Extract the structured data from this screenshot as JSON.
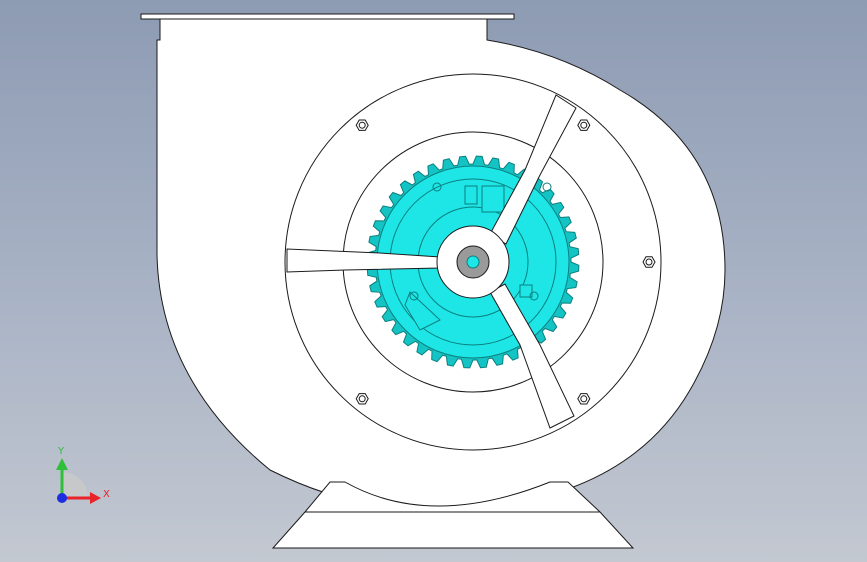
{
  "triad": {
    "x_label": "X",
    "y_label": "Y",
    "x_color": "#e8242a",
    "y_color": "#2fbf3a",
    "z_color": "#1c2ee0"
  },
  "colors": {
    "body_fill": "#ffffff",
    "outline": "#1a1a1a",
    "impeller_light": "#1ee6e6",
    "impeller_mid": "#14c4c4",
    "impeller_dark": "#0e9c9c",
    "hub_gray": "#9a9a9a"
  },
  "parts": {
    "impeller_teeth": 40,
    "spokes": 3,
    "bolt_holes": 6
  }
}
